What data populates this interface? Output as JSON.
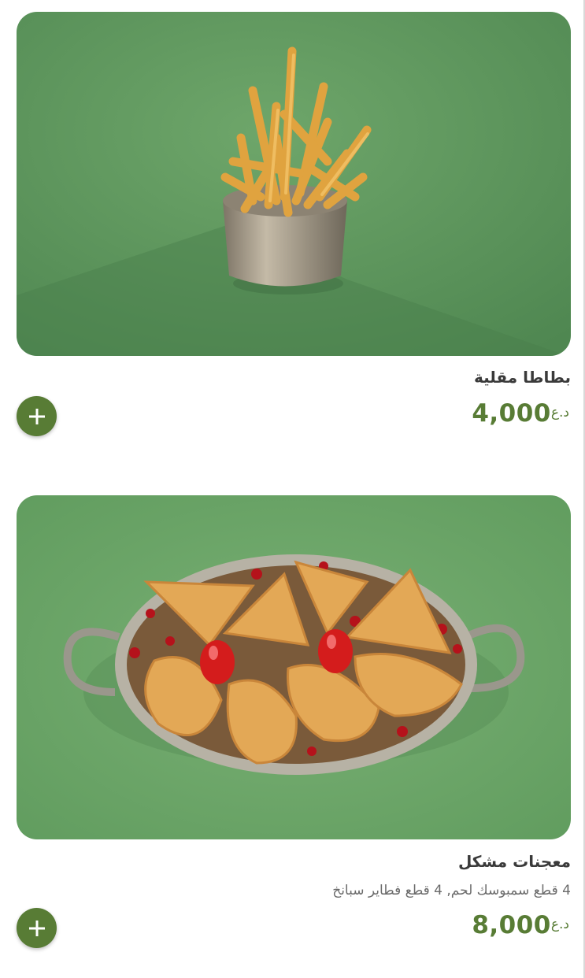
{
  "items": [
    {
      "name": "بطاطا مقلية",
      "description": "",
      "price": "4,000",
      "currency": "د.ع",
      "image_icon": "fries-photo"
    },
    {
      "name": "معجنات مشكل",
      "description": "4 قطع سمبوسك لحم, 4 قطع فطاير سبانخ",
      "price": "8,000",
      "currency": "د.ع",
      "image_icon": "pastries-photo"
    }
  ],
  "add_button_icon": "plus-icon",
  "colors": {
    "accent": "#587c35",
    "background_green": "#6aa167"
  }
}
